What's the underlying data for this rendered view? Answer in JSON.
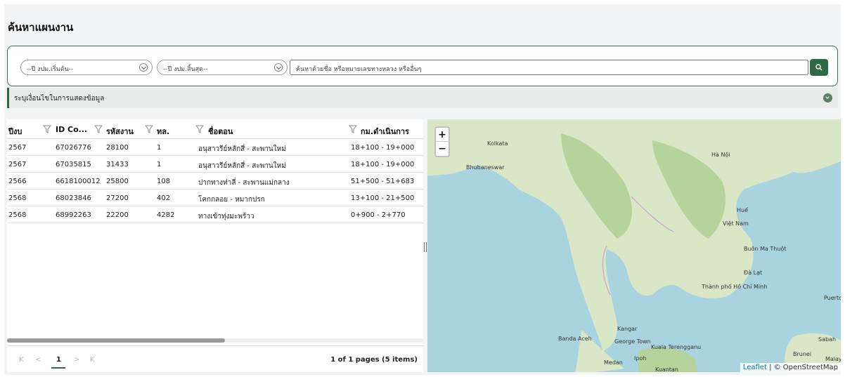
{
  "page": {
    "title": "ค้นหาแผนงาน"
  },
  "filters": {
    "year_start_placeholder": "--ปี งปม.เริ่มต้น--",
    "year_end_placeholder": "--ปี งปม.สิ้นสุด--",
    "search_placeholder": "ค้นหาด้วยชื่อ หรือหมายเลขทางหลวง หรืออื่นๆ",
    "search_icon": "search-icon"
  },
  "condition_bar": {
    "label": "ระบุเงื่อนไขในการแสดงข้อมูล"
  },
  "grid": {
    "columns": [
      "ปีงบ",
      "ID Co...",
      "รหัสงาน",
      "ทล.",
      "ชื่อตอน",
      "กม.ดำเนินการ"
    ],
    "rows": [
      [
        "2567",
        "67026776",
        "28100",
        "1",
        "อนุสาวรีย์หลักสี่ - สะพานใหม่",
        "18+100 - 19+000"
      ],
      [
        "2567",
        "67035815",
        "31433",
        "1",
        "อนุสาวรีย์หลักสี่ - สะพานใหม่",
        "18+100 - 19+000"
      ],
      [
        "2566",
        "6618100012",
        "25800",
        "108",
        "ปากทางท่าลี่ - สะพานแม่กลาง",
        "51+500 - 51+683"
      ],
      [
        "2568",
        "68023846",
        "27200",
        "402",
        "โคกกลอย - หมากปรก",
        "13+100 - 21+500"
      ],
      [
        "2568",
        "68992263",
        "22200",
        "4282",
        "ทางเข้าทุ่งมะพร้าว",
        "0+900 - 2+770"
      ]
    ]
  },
  "pager": {
    "first": "K",
    "prev": "<",
    "current": "1",
    "next": ">",
    "last": "K",
    "info": "1 of 1 pages (5 items)"
  },
  "map": {
    "zoom_in": "+",
    "zoom_out": "−",
    "attribution_leaflet": "Leaflet",
    "attribution_sep": " | © ",
    "attribution_osm": "OpenStreetMap",
    "labels": [
      "Kolkata",
      "Bhubaneswar",
      "Hà Nội",
      "Huế",
      "Việt Nam",
      "Buôn Ma Thuột",
      "Đà Lạt",
      "Thành phố Hồ Chí Minh",
      "Kangar",
      "Banda Aceh",
      "George Town",
      "Kuala Terengganu",
      "Medan",
      "Ipoh",
      "Kuantan",
      "Brunei",
      "Puerto",
      "Malay",
      "Sabah"
    ],
    "colors": {
      "sea": "#a9d3df",
      "land": "#d9e7c7",
      "forest": "#b5d39a"
    }
  }
}
